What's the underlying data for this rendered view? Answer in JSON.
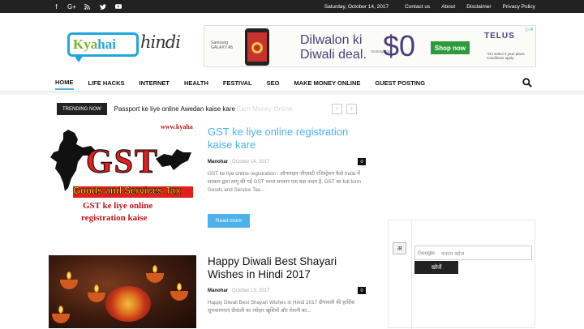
{
  "topbar": {
    "date": "Saturday, October 14, 2017",
    "links": [
      "Contact us",
      "About",
      "Disclaimer",
      "Privacy Policy"
    ],
    "social": [
      "facebook-icon",
      "google-plus-icon",
      "rss-icon",
      "twitter-icon",
      "youtube-icon"
    ]
  },
  "logo": {
    "part1": "Kya",
    "part2": "hai",
    "part3": "hindi"
  },
  "ad": {
    "brand_line1": "Samsung",
    "brand_line2": "GALAXY A5",
    "headline_line1": "Dilwalon ki",
    "headline_line2": "Diwali deal.",
    "starting": "Starting from",
    "price": "$0",
    "cta": "Shop now",
    "advertiser": "TELUS",
    "fine_print_line1": "*On select 2 year plans.",
    "fine_print_line2": "Conditions apply."
  },
  "nav": {
    "items": [
      "HOME",
      "LIFE HACKS",
      "INTERNET",
      "HEALTH",
      "FESTIVAL",
      "SEO",
      "MAKE MONEY ONLINE",
      "GUEST POSTING"
    ]
  },
  "trending": {
    "label": "TRENDING NOW",
    "headline": "Passport ke liye online Awedan kaise kare",
    "faded": "Earn Money Online"
  },
  "posts": [
    {
      "title": "GST ke liye online registration kaise kare",
      "author": "Manohar",
      "date": "October 14, 2017",
      "comments": "0",
      "excerpt": "GST ke liye online registration : ऑनलाइन जीएसटी रजिस्ट्रेशन कैसे India में सरकार द्वारा लागू की गई GST भारत सरकार एक बड़ा कदम है. GST का full form Goods and Service Tax...",
      "read_more": "Read more",
      "thumb": {
        "site": "www.kyaha",
        "big": "GST",
        "sub": "Goods and Services Tax",
        "line1": "GST ke liye online",
        "line2": "registration kaise"
      }
    },
    {
      "title": "Happy Diwali Best Shayari Wishes in Hindi 2017",
      "author": "Manohar",
      "date": "October 13, 2017",
      "comments": "0",
      "excerpt": "Happy Diwali Best Shayari Wishes in Hindi 2017 दीपावली की हार्दिक शुभकामनाएं दीवाली का त्योहार खुशियों और रोशनी का..."
    }
  ],
  "sidebar": {
    "translit_char": "अ",
    "search_brand": "Google",
    "search_placeholder": "कस्टम खोज",
    "search_button": "खोजें"
  }
}
